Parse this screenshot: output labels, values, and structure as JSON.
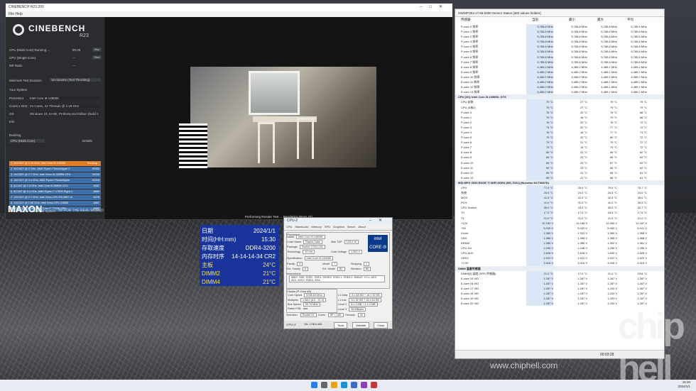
{
  "watermark": {
    "url": "www.chiphell.com",
    "logo": "chip hell"
  },
  "cinebench": {
    "title": "CINEBENCH R23.200",
    "menu": "File  Help",
    "brand": "CINEBENCH",
    "version": "R23",
    "tests": [
      {
        "label": "CPU (Multi Core)  Running ...",
        "score": "80.05",
        "button": "Stop"
      },
      {
        "label": "CPU (Single Core)",
        "score": "---",
        "button": "Start"
      },
      {
        "label": "MP Ratio",
        "score": "---",
        "button": ""
      }
    ],
    "min_duration_label": "Minimum Test Duration",
    "min_duration_value": "10 minutes (Test Throttling)",
    "system_header": "Your System",
    "system": [
      {
        "label": "Processor",
        "value": "Intel Core i9-14900K"
      },
      {
        "label": "Cores x GHz",
        "value": "24 Cores, 32 Threads @ 3.19 GHz"
      },
      {
        "label": "OS",
        "value": "Windows 10, 64 Bit, Professional Edition (build 2"
      },
      {
        "label": "Info",
        "value": ""
      }
    ],
    "ranking_header": "Ranking",
    "ranking_select": "CPU (Multi Core)",
    "ranking_details": "Details",
    "ranking": [
      {
        "name": "1. 24C/32T @ 3.19 GHz, Intel Core i9-14900K",
        "score": "Running...",
        "color": "#e07d28"
      },
      {
        "name": "2. 32C/64T @ 3 GHz, AMD Ryzen Threadripper 2",
        "score": "30054",
        "color": "#3f6fa8"
      },
      {
        "name": "3. 24C/48T @ 2.7 GHz, Intel Xeon W-3265M CPU",
        "score": "24243",
        "color": "#3f6fa8"
      },
      {
        "name": "4. 16C/32T @ 3.4 GHz, AMD Ryzen Threadripper",
        "score": "16315",
        "color": "#3f6fa8"
      },
      {
        "name": "5. 8C/16T @ 2.3 GHz, Intel Core i9-9880H CPU",
        "score": "9087",
        "color": "#3f6fa8"
      },
      {
        "name": "6. 8C/16T @ 3.4 GHz, AMD Ryzen 7 1700X Eight-C",
        "score": "8889",
        "color": "#3f6fa8"
      },
      {
        "name": "7. 12C/24T @ 2.7 GHz, Intel Xeon CPU E5-2697 v2",
        "score": "8378",
        "color": "#3f6fa8"
      },
      {
        "name": "8. 12C/24T @ 2.66 GHz, Intel Xeon CPU X5650",
        "score": "6867",
        "color": "#3f6fa8"
      },
      {
        "name": "9. 4C/8T @ 4.2 GHz, Intel Core i7-7700K CPU",
        "score": "6302",
        "color": "#3f6fa8"
      }
    ],
    "legend": [
      "Your Score",
      "Identical System"
    ],
    "footer_brand": "MAXON",
    "footer_tagline": "3D FOR THE REAL WORLD",
    "render_status": "Performing Render Test ... Rendering (Pass 32)"
  },
  "info_panel": {
    "rows": [
      {
        "label": "日期",
        "value": "2024/1/1",
        "color": "white"
      },
      {
        "label": "时间(HH:mm)",
        "value": "15:30",
        "color": "white"
      },
      {
        "label": "存取速度",
        "value": "DDR4-3200",
        "color": "white"
      },
      {
        "label": "内存时序",
        "value": "14-14-14-34 CR2",
        "color": "white"
      },
      {
        "label": "主板",
        "value": "24°C",
        "color": "yellow"
      },
      {
        "label": "DIMM2",
        "value": "21°C",
        "color": "yellow"
      },
      {
        "label": "DIMM4",
        "value": "21°C",
        "color": "yellow"
      }
    ]
  },
  "cpuz": {
    "title": "CPU-Z",
    "tabs": [
      "CPU",
      "Mainboard",
      "Memory",
      "SPD",
      "Graphics",
      "Bench",
      "About"
    ],
    "processor_group": "Processor",
    "fields": [
      {
        "label": "Name",
        "value": "Intel Core i9-14900K"
      },
      {
        "label": "Code Name",
        "value": "Raptor Lake"
      },
      {
        "label": "Max TDP",
        "value": "125.0 W"
      },
      {
        "label": "Package",
        "value": "Socket 1700 LGA"
      },
      {
        "label": "Technology",
        "value": "10 nm"
      },
      {
        "label": "Core Voltage",
        "value": "1.302 V"
      },
      {
        "label": "Specification",
        "value": "Intel Core i9-14900K"
      },
      {
        "label": "Family",
        "value": "6"
      },
      {
        "label": "Model",
        "value": "7"
      },
      {
        "label": "Stepping",
        "value": "1"
      },
      {
        "label": "Ext. Family",
        "value": "6"
      },
      {
        "label": "Ext. Model",
        "value": "B7"
      },
      {
        "label": "Revision",
        "value": "B0"
      },
      {
        "label": "Instructions",
        "value": "MMX, SSE, SSE2, SSE3, SSSE3, SSE4.1, SSE4.2, EM64T, VT-x, AES, AVX, AVX2, FMA3, SHA"
      }
    ],
    "badge": "intel CORE i9",
    "clocks_group": "Clocks (P-Core #0)",
    "clocks": [
      {
        "label": "Core Speed",
        "value": "5785.83 MHz"
      },
      {
        "label": "Multiplier",
        "value": "x 58.0 (8.0 - 57.0)"
      },
      {
        "label": "Bus Speed",
        "value": "99.76 MHz"
      },
      {
        "label": "Rated FSB",
        "value": ""
      }
    ],
    "cache": [
      {
        "label": "L1 Data",
        "value": "8 x 48 KB + 16 x 32 KB"
      },
      {
        "label": "L1 Inst.",
        "value": "8 x 32 KB + 16 x 64 KB"
      },
      {
        "label": "Level 2",
        "value": "8 x 2 MB + 4 x 4 MB"
      },
      {
        "label": "Level 3",
        "value": "36 MBytes"
      }
    ],
    "selection_label": "Selection",
    "selection_value": "Socket #1",
    "cores_label": "Cores",
    "cores_value": "8P + 16E",
    "threads_label": "Threads",
    "threads_value": "32",
    "footer_brand": "CPU-Z",
    "footer_ver": "Ver. 2.08.0.x64",
    "tools": "Tools",
    "validate": "Validate",
    "close": "Close"
  },
  "hwinfo": {
    "title": "HWiNFO64 v7.68-5300 Sensor Status [382 values hidden]",
    "columns": [
      "传感器",
      "当前",
      "最小",
      "最大",
      "平均"
    ],
    "rows": [
      {
        "n": "P-core 0 频率",
        "v": [
          "5,785.8 MHz",
          "5,785.8 MHz",
          "5,785.8 MHz",
          "5,785.8 MHz"
        ]
      },
      {
        "n": "P-core 1 频率",
        "v": [
          "5,785.8 MHz",
          "5,785.8 MHz",
          "5,785.8 MHz",
          "5,785.8 MHz"
        ]
      },
      {
        "n": "P-core 2 频率",
        "v": [
          "5,785.8 MHz",
          "5,785.8 MHz",
          "5,785.8 MHz",
          "5,785.8 MHz"
        ]
      },
      {
        "n": "P-core 3 频率",
        "v": [
          "5,785.8 MHz",
          "5,785.8 MHz",
          "5,785.8 MHz",
          "5,785.8 MHz"
        ]
      },
      {
        "n": "P-core 4 频率",
        "v": [
          "5,785.8 MHz",
          "5,785.8 MHz",
          "5,785.8 MHz",
          "5,785.8 MHz"
        ]
      },
      {
        "n": "P-core 5 频率",
        "v": [
          "5,785.8 MHz",
          "5,785.8 MHz",
          "5,785.8 MHz",
          "5,785.8 MHz"
        ]
      },
      {
        "n": "P-core 6 频率",
        "v": [
          "5,785.8 MHz",
          "5,785.8 MHz",
          "5,785.8 MHz",
          "5,785.8 MHz"
        ]
      },
      {
        "n": "P-core 7 频率",
        "v": [
          "5,785.8 MHz",
          "5,785.8 MHz",
          "5,785.8 MHz",
          "5,785.8 MHz"
        ]
      },
      {
        "n": "E-core 8 频率",
        "v": [
          "4,489.2 MHz",
          "4,489.2 MHz",
          "4,489.2 MHz",
          "4,489.2 MHz"
        ]
      },
      {
        "n": "E-core 9 频率",
        "v": [
          "4,489.2 MHz",
          "4,489.2 MHz",
          "4,489.2 MHz",
          "4,489.2 MHz"
        ]
      },
      {
        "n": "E-core 10 频率",
        "v": [
          "4,489.2 MHz",
          "4,489.2 MHz",
          "4,489.2 MHz",
          "4,489.2 MHz"
        ]
      },
      {
        "n": "E-core 11 频率",
        "v": [
          "4,489.2 MHz",
          "4,489.2 MHz",
          "4,489.2 MHz",
          "4,489.2 MHz"
        ]
      },
      {
        "n": "E-core 12 频率",
        "v": [
          "4,489.2 MHz",
          "4,489.2 MHz",
          "4,489.2 MHz",
          "4,489.2 MHz"
        ]
      },
      {
        "n": "E-core 13 频率",
        "v": [
          "4,489.2 MHz",
          "4,489.2 MHz",
          "4,489.2 MHz",
          "4,489.2 MHz"
        ]
      },
      {
        "n": "CPU [#0]: Intel Core i9-14900K: DTS",
        "sec": true
      },
      {
        "n": "CPU 封装",
        "v": [
          "79 °C",
          "27 °C",
          "79 °C",
          "79 °C"
        ]
      },
      {
        "n": "CPU IA核心",
        "v": [
          "79 °C",
          "27 °C",
          "79 °C",
          "79 °C"
        ]
      },
      {
        "n": "P-core 0",
        "v": [
          "76 °C",
          "22 °C",
          "76 °C",
          "68 °C"
        ]
      },
      {
        "n": "P-core 1",
        "v": [
          "79 °C",
          "18 °C",
          "79 °C",
          "66 °C"
        ]
      },
      {
        "n": "P-core 2",
        "v": [
          "76 °C",
          "20 °C",
          "76 °C",
          "72 °C"
        ]
      },
      {
        "n": "P-core 3",
        "v": [
          "74 °C",
          "20 °C",
          "77 °C",
          "72 °C"
        ]
      },
      {
        "n": "P-core 4",
        "v": [
          "76 °C",
          "18 °C",
          "77 °C",
          "71 °C"
        ]
      },
      {
        "n": "P-core 5",
        "v": [
          "79 °C",
          "20 °C",
          "80 °C",
          "72 °C"
        ]
      },
      {
        "n": "P-core 6",
        "v": [
          "79 °C",
          "21 °C",
          "79 °C",
          "72 °C"
        ]
      },
      {
        "n": "P-core 7",
        "v": [
          "79 °C",
          "19 °C",
          "79 °C",
          "72 °C"
        ]
      },
      {
        "n": "E-core 8",
        "v": [
          "65 °C",
          "23 °C",
          "66 °C",
          "62 °C"
        ]
      },
      {
        "n": "E-core 9",
        "v": [
          "65 °C",
          "23 °C",
          "66 °C",
          "62 °C"
        ]
      },
      {
        "n": "E-core 10",
        "v": [
          "65 °C",
          "23 °C",
          "67 °C",
          "62 °C"
        ]
      },
      {
        "n": "E-core 11",
        "v": [
          "65 °C",
          "23 °C",
          "66 °C",
          "62 °C"
        ]
      },
      {
        "n": "E-core 12",
        "v": [
          "65 °C",
          "21 °C",
          "66 °C",
          "61 °C"
        ]
      },
      {
        "n": "E-core 13",
        "v": [
          "65 °C",
          "21 °C",
          "66 °C",
          "61 °C"
        ]
      },
      {
        "n": "MSI MPG Z690 EDGE TI WIFI DDR4 (MS-7D31) (Nuvoton NCT6687D)",
        "sec": true
      },
      {
        "n": "CPU",
        "v": [
          "77.5 °C",
          "25.0 °C",
          "79.5 °C",
          "75.7 °C"
        ]
      },
      {
        "n": "系统",
        "v": [
          "24.0 °C",
          "24.0 °C",
          "24.5 °C",
          "24.0 °C"
        ]
      },
      {
        "n": "MOS",
        "v": [
          "41.5 °C",
          "22.5 °C",
          "42.5 °C",
          "38.6 °C"
        ]
      },
      {
        "n": "PCH",
        "v": [
          "41.0 °C",
          "22.0 °C",
          "41.0 °C",
          "35.5 °C"
        ]
      },
      {
        "n": "CPU Socket",
        "v": [
          "35.0 °C",
          "23.0 °C",
          "35.5 °C",
          "32.7 °C"
        ]
      },
      {
        "n": "T0",
        "v": [
          "17.5 °C",
          "17.5 °C",
          "18.5 °C",
          "17.6 °C"
        ]
      },
      {
        "n": "T1",
        "v": [
          "21.0 °C",
          "21.0 °C",
          "21.5 °C",
          "21.0 °C"
        ]
      },
      {
        "n": "+12V",
        "v": [
          "12.152 V",
          "12.188 V",
          "12.260 V",
          "12.187 V"
        ]
      },
      {
        "n": "+5V",
        "v": [
          "5.040 V",
          "5.020 V",
          "5.060 V",
          "5.041 V"
        ]
      },
      {
        "n": "Vcore",
        "v": [
          "1.380 V",
          "1.302 V",
          "1.380 V",
          "1.368 V"
        ]
      },
      {
        "n": "VDD",
        "v": [
          "1.368 V",
          "1.368 V",
          "1.368 V",
          "1.368 V"
        ]
      },
      {
        "n": "DRAM",
        "v": [
          "1.380 V",
          "1.380 V",
          "1.392 V",
          "1.381 V"
        ]
      },
      {
        "n": "CPU SA",
        "v": [
          "1.250 V",
          "1.248 V",
          "1.250 V",
          "1.250 V"
        ]
      },
      {
        "n": "CPU AUX",
        "v": [
          "1.828 V",
          "1.828 V",
          "1.830 V",
          "1.828 V"
        ]
      },
      {
        "n": "VDD2",
        "v": [
          "1.522 V",
          "1.522 V",
          "1.522 V",
          "1.522 V"
        ]
      },
      {
        "n": "+3.3V",
        "v": [
          "3.316 V",
          "3.316 V",
          "3.336 V",
          "3.316 V"
        ]
      },
      {
        "n": "DIMM 温度传感器",
        "sec": true
      },
      {
        "n": "DIMM[2] 温度 (SPD 传感器)",
        "v": [
          "21.0 °C",
          "17.0 °C",
          "21.0 °C",
          "19.8 °C"
        ]
      },
      {
        "n": "E-core 15 VID",
        "v": [
          "1.287 V",
          "1.287 V",
          "1.287 V",
          "1.287 V"
        ]
      },
      {
        "n": "E-core 16 VID",
        "v": [
          "1.287 V",
          "1.287 V",
          "1.287 V",
          "1.287 V"
        ]
      },
      {
        "n": "E-core 17 VID",
        "v": [
          "1.287 V",
          "1.287 V",
          "1.293 V",
          "1.287 V"
        ]
      },
      {
        "n": "E-core 18 VID",
        "v": [
          "1.287 V",
          "1.287 V",
          "1.293 V",
          "1.287 V"
        ]
      },
      {
        "n": "E-core 19 VID",
        "v": [
          "1.287 V",
          "1.287 V",
          "1.293 V",
          "1.287 V"
        ]
      },
      {
        "n": "E-core 20 VID",
        "v": [
          "1.287 V",
          "1.287 V",
          "1.293 V",
          "1.287 V"
        ]
      }
    ],
    "footer_time": "00:03:28"
  },
  "taskbar": {
    "time": "15:30",
    "date": "2024/1/1"
  }
}
